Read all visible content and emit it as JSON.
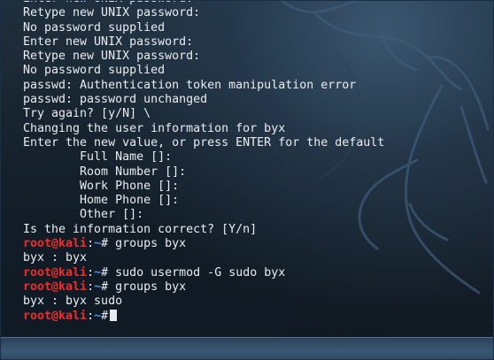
{
  "terminal": {
    "lines": [
      {
        "type": "text",
        "text": "Enter new UNIX password:"
      },
      {
        "type": "text",
        "text": "Retype new UNIX password:"
      },
      {
        "type": "text",
        "text": "No password supplied"
      },
      {
        "type": "text",
        "text": "Enter new UNIX password:"
      },
      {
        "type": "text",
        "text": "Retype new UNIX password:"
      },
      {
        "type": "text",
        "text": "No password supplied"
      },
      {
        "type": "text",
        "text": "passwd: Authentication token manipulation error"
      },
      {
        "type": "text",
        "text": "passwd: password unchanged"
      },
      {
        "type": "text",
        "text": "Try again? [y/N] \\"
      },
      {
        "type": "text",
        "text": "Changing the user information for byx"
      },
      {
        "type": "text",
        "text": "Enter the new value, or press ENTER for the default"
      },
      {
        "type": "text",
        "text": "        Full Name []:"
      },
      {
        "type": "text",
        "text": "        Room Number []:"
      },
      {
        "type": "text",
        "text": "        Work Phone []:"
      },
      {
        "type": "text",
        "text": "        Home Phone []:"
      },
      {
        "type": "text",
        "text": "        Other []:"
      },
      {
        "type": "text",
        "text": "Is the information correct? [Y/n]"
      },
      {
        "type": "prompt",
        "user": "root@kali",
        "sep": ":",
        "path": "~",
        "symbol": "#",
        "command": " groups byx"
      },
      {
        "type": "text",
        "text": "byx : byx"
      },
      {
        "type": "prompt",
        "user": "root@kali",
        "sep": ":",
        "path": "~",
        "symbol": "#",
        "command": " sudo usermod -G sudo byx"
      },
      {
        "type": "prompt",
        "user": "root@kali",
        "sep": ":",
        "path": "~",
        "symbol": "#",
        "command": " groups byx"
      },
      {
        "type": "text",
        "text": "byx : byx sudo"
      },
      {
        "type": "prompt",
        "user": "root@kali",
        "sep": ":",
        "path": "~",
        "symbol": "#",
        "command": "",
        "cursor": true
      }
    ]
  },
  "colors": {
    "prompt_user": "#ef2d2d",
    "prompt_path": "#5a8bf0",
    "text": "#e9edf1",
    "background": "#17222d"
  },
  "icons": {
    "background": "kali-dragon-watermark"
  }
}
